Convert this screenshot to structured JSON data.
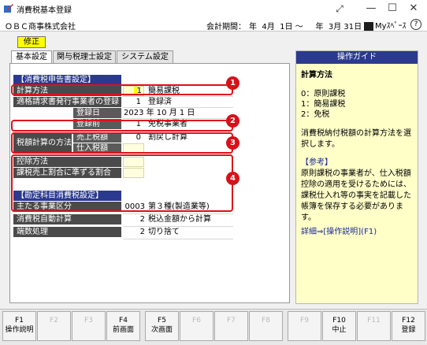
{
  "window": {
    "title": "消費税基本登録",
    "controls": {
      "minimize": "—",
      "maximize": "☐",
      "close": "✕",
      "expand_icon": "expand-arrows-icon"
    }
  },
  "infobar": {
    "company": "ＯＢＣ商事株式会社",
    "period_label": "会計期間：",
    "period_value": "年  4月  1日 ～     年  3月 31日",
    "myspace": "Myｽﾍﾟｰｽ",
    "help": "?"
  },
  "mode_badge": "修正",
  "tabs": [
    {
      "label": "基本設定",
      "active": true
    },
    {
      "label": "関与税理士設定",
      "active": false
    },
    {
      "label": "システム設定",
      "active": false
    }
  ],
  "form": {
    "section1_header": "【消費税申告書設定】",
    "rows": {
      "keisan_houhou": {
        "label": "計算方法",
        "code": "1",
        "value": "簡易課税"
      },
      "tekikaku_touroku": {
        "label": "適格請求書発行事業者の登録",
        "code": "1",
        "value": "登録済"
      },
      "touroku_bi": {
        "label": "登録日",
        "value": "2023 年 10 月  1 日"
      },
      "touroku_mae": {
        "label": "登録前",
        "code": "1",
        "value": "免税事業者"
      },
      "zeigaku_keisan": {
        "label": "税額計算の方法"
      },
      "uriage_zeigaku": {
        "label": "売上税額",
        "code": "0",
        "value": "割戻し計算"
      },
      "shiire_zeigaku": {
        "label": "仕入税額",
        "code": "",
        "value": ""
      },
      "koujo_houhou": {
        "label": "控除方法",
        "code": "",
        "value": ""
      },
      "kazei_uriage": {
        "label": "課税売上割合に準ずる割合",
        "code": "",
        "value": ""
      }
    },
    "section2_header": "【勘定科目消費税設定】",
    "rows2": {
      "omo_jigyou": {
        "label": "主たる事業区分",
        "code": "0003",
        "value": "第３種(製造業等)"
      },
      "jidou_keisan": {
        "label": "消費税自動計算",
        "code": "2",
        "value": "税込金額から計算"
      },
      "hasuu_shori": {
        "label": "端数処理",
        "code": "2",
        "value": "切り捨て"
      }
    }
  },
  "annotations": [
    "1",
    "2",
    "3",
    "4"
  ],
  "guide": {
    "header": "操作ガイド",
    "title": "計算方法",
    "options": [
      "0：原則課税",
      "1：簡易課税",
      "2：免税"
    ],
    "description": "消費税納付税額の計算方法を選択します。",
    "ref_title": "【参考】",
    "ref_body": "原則課税の事業者が、仕入税額控除の適用を受けるためには、課税仕入れ等の事実を記載した帳簿を保存する必要があります。",
    "link": "詳細⇒[操作説明](F1)"
  },
  "fkeys": [
    {
      "key": "F1",
      "label": "操作説明",
      "enabled": true
    },
    {
      "key": "F2",
      "label": "",
      "enabled": false
    },
    {
      "key": "F3",
      "label": "",
      "enabled": false
    },
    {
      "key": "F4",
      "label": "前画面",
      "enabled": true
    },
    {
      "key": "F5",
      "label": "次画面",
      "enabled": true
    },
    {
      "key": "F6",
      "label": "",
      "enabled": false
    },
    {
      "key": "F7",
      "label": "",
      "enabled": false
    },
    {
      "key": "F8",
      "label": "",
      "enabled": false
    },
    {
      "key": "F9",
      "label": "",
      "enabled": false
    },
    {
      "key": "F10",
      "label": "中止",
      "enabled": true
    },
    {
      "key": "F11",
      "label": "",
      "enabled": false
    },
    {
      "key": "F12",
      "label": "登録",
      "enabled": true
    }
  ]
}
